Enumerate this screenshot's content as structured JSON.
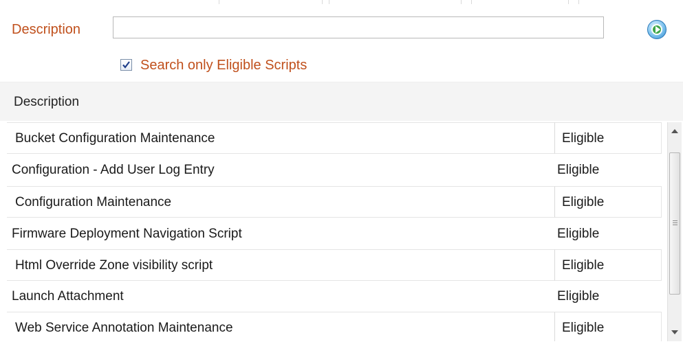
{
  "search": {
    "label": "Description",
    "value": "",
    "placeholder": "",
    "checkbox_label": "Search only Eligible Scripts",
    "checkbox_checked": true
  },
  "results": {
    "column_header": "Description",
    "rows": [
      {
        "description": "Bucket Configuration Maintenance",
        "status": "Eligible"
      },
      {
        "description": "Configuration - Add User Log Entry",
        "status": "Eligible"
      },
      {
        "description": "Configuration Maintenance",
        "status": "Eligible"
      },
      {
        "description": "Firmware Deployment Navigation Script",
        "status": "Eligible"
      },
      {
        "description": "Html Override Zone visibility script",
        "status": "Eligible"
      },
      {
        "description": "Launch Attachment",
        "status": "Eligible"
      },
      {
        "description": "Web Service Annotation Maintenance",
        "status": "Eligible"
      }
    ]
  },
  "icons": {
    "go": "go-arrow-icon",
    "checkbox": "checkmark-icon",
    "scroll_up": "scroll-up-arrow-icon",
    "scroll_down": "scroll-down-arrow-icon"
  },
  "colors": {
    "label_text": "#c0501c",
    "header_bg": "#f4f4f4"
  }
}
